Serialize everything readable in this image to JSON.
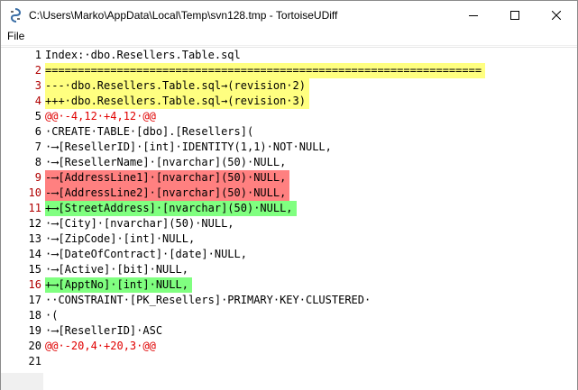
{
  "window": {
    "title": "C:\\Users\\Marko\\AppData\\Local\\Temp\\svn128.tmp - TortoiseUDiff"
  },
  "menu": {
    "file": "File"
  },
  "lines": [
    {
      "num": "1",
      "text": "Index:·dbo.Resellers.Table.sql",
      "kind": "plain"
    },
    {
      "num": "2",
      "text": "===================================================================",
      "kind": "hdr"
    },
    {
      "num": "3",
      "text": "---·dbo.Resellers.Table.sql→(revision·2)",
      "kind": "hdr"
    },
    {
      "num": "4",
      "text": "+++·dbo.Resellers.Table.sql→(revision·3)",
      "kind": "hdr"
    },
    {
      "num": "5",
      "text": "@@·-4,12·+4,12·@@",
      "kind": "range"
    },
    {
      "num": "6",
      "text": "·CREATE·TABLE·[dbo].[Resellers](",
      "kind": "plain"
    },
    {
      "num": "7",
      "text": "·⟶[ResellerID]·[int]·IDENTITY(1,1)·NOT·NULL,",
      "kind": "plain"
    },
    {
      "num": "8",
      "text": "·⟶[ResellerName]·[nvarchar](50)·NULL,",
      "kind": "plain"
    },
    {
      "num": "9",
      "text": "-⟶[AddressLine1]·[nvarchar](50)·NULL,",
      "kind": "del"
    },
    {
      "num": "10",
      "text": "-⟶[AddressLine2]·[nvarchar](50)·NULL,",
      "kind": "del"
    },
    {
      "num": "11",
      "text": "+⟶[StreetAddress]·[nvarchar](50)·NULL,",
      "kind": "add"
    },
    {
      "num": "12",
      "text": "·⟶[City]·[nvarchar](50)·NULL,",
      "kind": "plain"
    },
    {
      "num": "13",
      "text": "·⟶[ZipCode]·[int]·NULL,",
      "kind": "plain"
    },
    {
      "num": "14",
      "text": "·⟶[DateOfContract]·[date]·NULL,",
      "kind": "plain"
    },
    {
      "num": "15",
      "text": "·⟶[Active]·[bit]·NULL,",
      "kind": "plain"
    },
    {
      "num": "16",
      "text": "+⟶[ApptNo]·[int]·NULL,",
      "kind": "add"
    },
    {
      "num": "17",
      "text": "··CONSTRAINT·[PK_Resellers]·PRIMARY·KEY·CLUSTERED·",
      "kind": "plain"
    },
    {
      "num": "18",
      "text": "·(",
      "kind": "plain"
    },
    {
      "num": "19",
      "text": "·⟶[ResellerID]·ASC",
      "kind": "plain"
    },
    {
      "num": "20",
      "text": "@@·-20,4·+20,3·@@",
      "kind": "range"
    },
    {
      "num": "21",
      "text": "",
      "kind": "plain"
    }
  ],
  "colors": {
    "header_bg": "#ffff80",
    "deleted_bg": "#ff8080",
    "added_bg": "#80ff80",
    "range_fg": "#e00000"
  },
  "icons": {
    "app": "tortoise-icon",
    "minimize": "minimize-icon",
    "maximize": "maximize-icon",
    "close": "close-icon"
  }
}
